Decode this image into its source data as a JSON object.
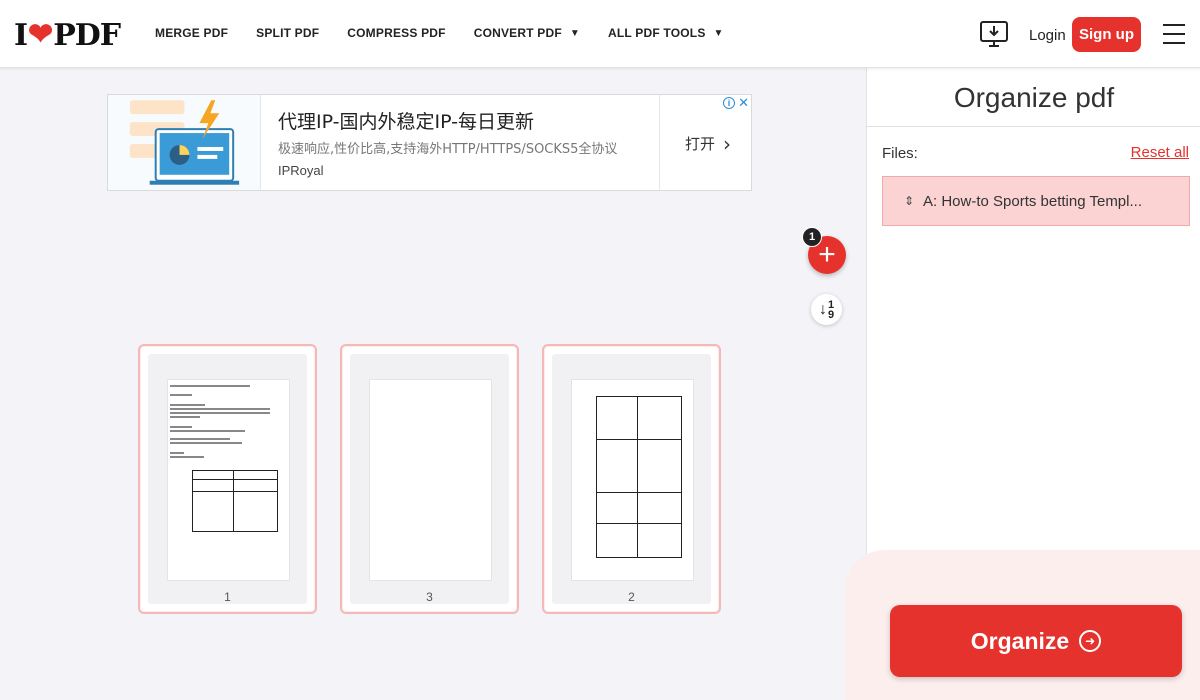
{
  "header": {
    "logo_left": "I",
    "logo_right": "PDF",
    "nav": [
      {
        "label": "MERGE PDF",
        "caret": false
      },
      {
        "label": "SPLIT PDF",
        "caret": false
      },
      {
        "label": "COMPRESS PDF",
        "caret": false
      },
      {
        "label": "CONVERT PDF",
        "caret": true
      },
      {
        "label": "ALL PDF TOOLS",
        "caret": true
      }
    ],
    "login": "Login",
    "signup": "Sign up"
  },
  "ad": {
    "title": "代理IP-国内外稳定IP-每日更新",
    "desc": "极速响应,性价比高,支持海外HTTP/HTTPS/SOCKS5全协议",
    "brand": "IPRoyal",
    "open": "打开"
  },
  "toolbar": {
    "badge_count": "1",
    "sort_label_top": "1",
    "sort_label_bottom": "9"
  },
  "pages": [
    {
      "number": "1"
    },
    {
      "number": "3"
    },
    {
      "number": "2"
    }
  ],
  "panel": {
    "title": "Organize pdf",
    "files_label": "Files:",
    "reset": "Reset all",
    "file_name": "A: How-to Sports betting Templ...",
    "organize": "Organize"
  },
  "colors": {
    "brand": "#e5322d",
    "file_highlight": "#fbd3d3"
  }
}
